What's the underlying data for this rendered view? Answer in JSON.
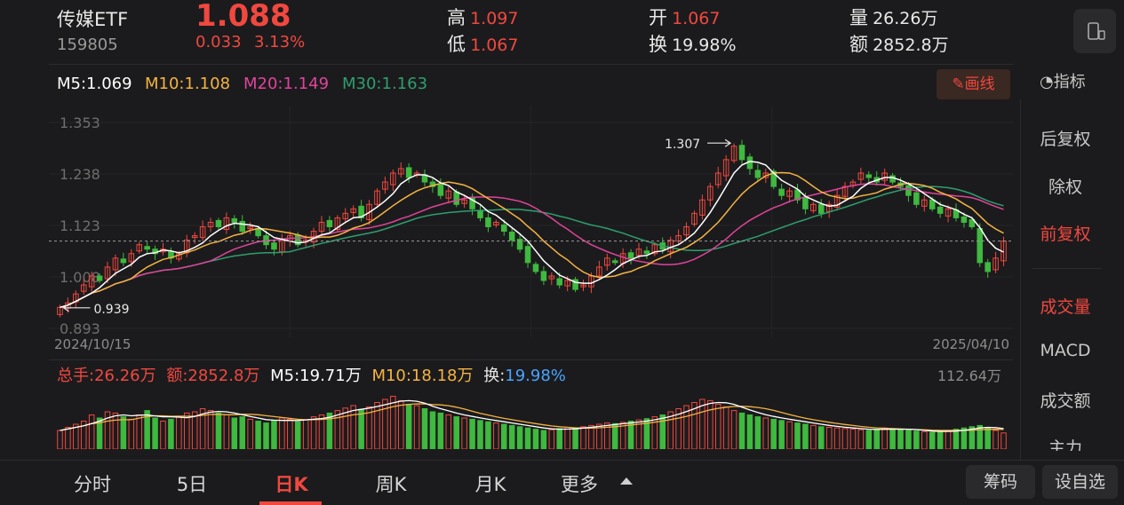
{
  "header": {
    "name": "传媒ETF",
    "code": "159805",
    "price": "1.088",
    "change": "0.033",
    "change_pct": "3.13%",
    "high_label": "高",
    "high_value": "1.097",
    "low_label": "低",
    "low_value": "1.067",
    "open_label": "开",
    "open_value": "1.067",
    "turnover_label": "换",
    "turnover_value": "19.98%",
    "volume_label": "量",
    "volume_value": "26.26万",
    "amount_label": "额",
    "amount_value": "2852.8万"
  },
  "ma_legend": {
    "m5": "M5:1.069",
    "m10": "M10:1.108",
    "m20": "M20:1.149",
    "m30": "M30:1.163"
  },
  "toolbar": {
    "draw_label": "画线",
    "indicator_label": "指标"
  },
  "price_chart": {
    "y_ticks": [
      "1.353",
      "1.238",
      "1.123",
      "1.008",
      "0.893"
    ],
    "high_marker": "1.307",
    "low_marker": "0.939",
    "start_date": "2024/10/15",
    "end_date": "2025/04/10"
  },
  "volume_legend": {
    "total": "总手:26.26万",
    "amount": "额:2852.8万",
    "m5": "M5:19.71万",
    "m10": "M10:18.18万",
    "turnover_label": "换:",
    "turnover_value": "19.98%",
    "max": "112.64万"
  },
  "sidebar": {
    "items": [
      "后复权",
      "除权",
      "前复权",
      "成交量",
      "MACD",
      "成交额",
      "主力"
    ],
    "active": "前复权"
  },
  "tabs": {
    "items": [
      "分时",
      "5日",
      "日K",
      "周K",
      "月K",
      "更多"
    ],
    "active": "日K"
  },
  "buttons": {
    "chips": "筹码",
    "watchlist": "设自选"
  },
  "colors": {
    "up": "#f0483f",
    "down": "#3fb93f",
    "m5": "#ffffff",
    "m10": "#f5b342",
    "m20": "#e0449a",
    "m30": "#2f9e6e",
    "accent": "#f0483f"
  },
  "chart_data": {
    "type": "candlestick",
    "closes": [
      0.94,
      0.95,
      0.97,
      0.99,
      1.01,
      1.0,
      1.03,
      1.05,
      1.04,
      1.06,
      1.08,
      1.07,
      1.06,
      1.07,
      1.05,
      1.06,
      1.09,
      1.1,
      1.12,
      1.13,
      1.12,
      1.14,
      1.13,
      1.11,
      1.12,
      1.1,
      1.08,
      1.07,
      1.09,
      1.1,
      1.08,
      1.09,
      1.11,
      1.13,
      1.12,
      1.14,
      1.15,
      1.16,
      1.14,
      1.17,
      1.2,
      1.22,
      1.24,
      1.25,
      1.23,
      1.24,
      1.22,
      1.21,
      1.19,
      1.2,
      1.17,
      1.18,
      1.16,
      1.14,
      1.12,
      1.13,
      1.11,
      1.09,
      1.07,
      1.04,
      1.02,
      1.0,
      1.01,
      0.99,
      1.0,
      0.98,
      0.99,
      1.01,
      1.03,
      1.05,
      1.04,
      1.06,
      1.05,
      1.07,
      1.06,
      1.08,
      1.07,
      1.09,
      1.1,
      1.12,
      1.15,
      1.18,
      1.21,
      1.24,
      1.27,
      1.3,
      1.27,
      1.25,
      1.23,
      1.24,
      1.21,
      1.19,
      1.2,
      1.18,
      1.16,
      1.17,
      1.15,
      1.17,
      1.19,
      1.21,
      1.22,
      1.24,
      1.23,
      1.22,
      1.24,
      1.22,
      1.21,
      1.19,
      1.17,
      1.18,
      1.16,
      1.15,
      1.16,
      1.14,
      1.13,
      1.12,
      1.04,
      1.02,
      1.05,
      1.088
    ],
    "volumes": [
      30,
      35,
      40,
      45,
      55,
      50,
      60,
      58,
      52,
      48,
      55,
      62,
      50,
      45,
      48,
      52,
      58,
      60,
      65,
      62,
      58,
      55,
      50,
      52,
      48,
      45,
      42,
      46,
      50,
      48,
      44,
      47,
      52,
      55,
      58,
      62,
      66,
      70,
      64,
      68,
      75,
      80,
      85,
      78,
      72,
      70,
      65,
      60,
      58,
      55,
      52,
      50,
      48,
      46,
      44,
      42,
      40,
      38,
      36,
      34,
      32,
      30,
      31,
      33,
      35,
      34,
      36,
      38,
      40,
      42,
      41,
      43,
      45,
      47,
      49,
      52,
      55,
      60,
      65,
      70,
      75,
      80,
      78,
      72,
      68,
      62,
      58,
      55,
      52,
      50,
      48,
      46,
      44,
      42,
      40,
      38,
      36,
      35,
      34,
      33,
      32,
      31,
      30,
      32,
      34,
      33,
      31,
      30,
      29,
      28,
      27,
      28,
      30,
      32,
      34,
      36,
      38,
      35,
      30,
      26
    ],
    "y_range": [
      0.893,
      1.353
    ],
    "volume_max": "112.64万"
  }
}
